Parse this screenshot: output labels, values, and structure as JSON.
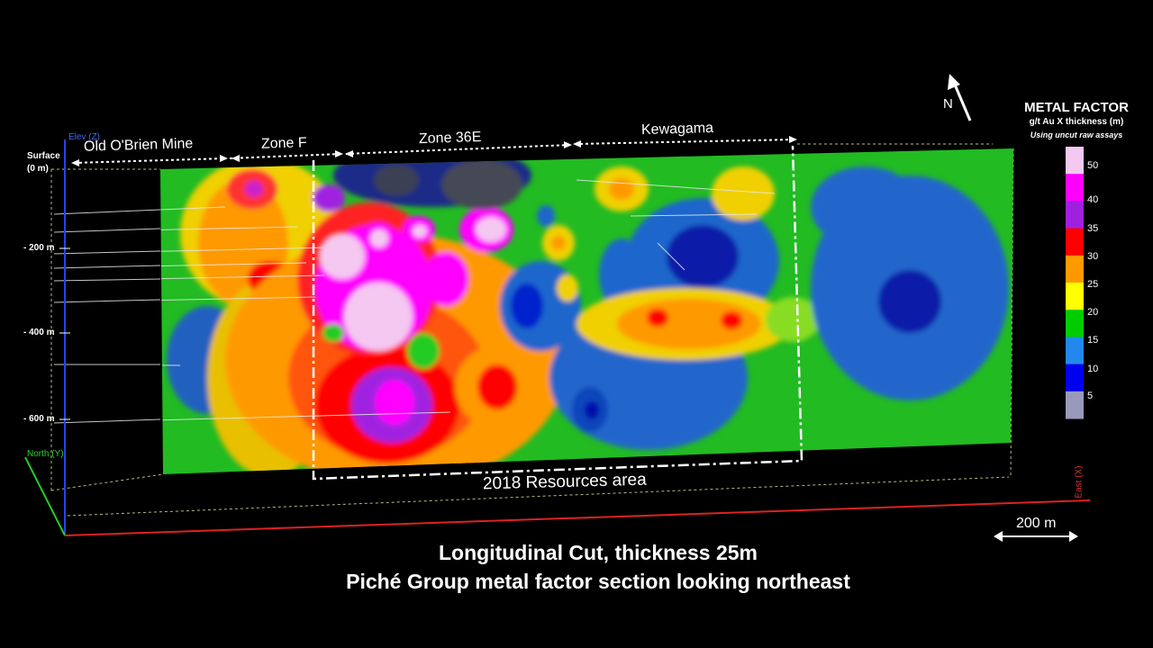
{
  "zones": {
    "old_obrien": "Old O'Brien Mine",
    "zone_f": "Zone F",
    "zone_36e": "Zone 36E",
    "kewagama": "Kewagama"
  },
  "depths": {
    "surface_line1": "Surface",
    "surface_line2": "(0 m)",
    "d200": "- 200 m",
    "d400": "- 400 m",
    "d600": "- 600 m"
  },
  "axes": {
    "elev": "Elev (Z)",
    "north": "North (Y)",
    "east": "East (X)"
  },
  "resources_label": "2018 Resources area",
  "north_arrow_label": "N",
  "scale_bar_label": "200 m",
  "legend": {
    "title": "METAL FACTOR",
    "subtitle": "g/t Au X thickness (m)",
    "note": "Using uncut raw assays",
    "entries": [
      {
        "label": "50",
        "color": "#f4c8f0"
      },
      {
        "label": "40",
        "color": "#ff00ff"
      },
      {
        "label": "",
        "color": "#a020e0"
      },
      {
        "label": "35",
        "color": "#ff0000"
      },
      {
        "label": "30",
        "color": "#ff9900"
      },
      {
        "label": "25",
        "color": "#ffff00"
      },
      {
        "label": "20",
        "color": "#00cc00"
      },
      {
        "label": "15",
        "color": "#2288ee"
      },
      {
        "label": "10",
        "color": "#0000ee"
      },
      {
        "label": "5",
        "color": "#9999bb"
      }
    ]
  },
  "caption": {
    "line1": "Longitudinal Cut, thickness 25m",
    "line2": "Piché Group metal factor section looking northeast"
  },
  "colors": {
    "background": "#000000",
    "section_base": "#22bb22",
    "elev_axis": "#2244ee",
    "north_axis": "#22cc22",
    "east_axis": "#dd2222"
  }
}
